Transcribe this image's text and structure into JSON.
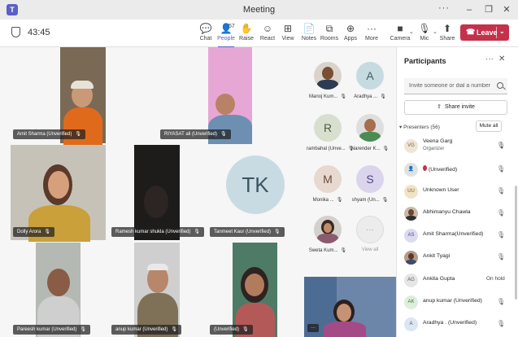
{
  "window": {
    "title": "Meeting",
    "app_icon": "teams-icon",
    "more": "···",
    "minimize": "–",
    "restore": "❐",
    "close": "✕"
  },
  "toolbar": {
    "timer": "43:45",
    "people_count": "57",
    "chat": "Chat",
    "people": "People",
    "raise": "Raise",
    "react": "React",
    "view": "View",
    "notes": "Notes",
    "rooms": "Rooms",
    "apps": "Apps",
    "more": "More",
    "camera": "Camera",
    "mic": "Mic",
    "share": "Share",
    "leave": "Leave",
    "leave_color": "#c4314b",
    "accent": "#5b5fc7"
  },
  "videos": [
    {
      "name": "Amit Sharma (Unverified)"
    },
    {
      "name": "RIYASAT ali (Unverified)"
    },
    {
      "name": "Dolly Arora"
    },
    {
      "name": "Ramesh kumar shukla (Unverified)"
    },
    {
      "name": "Tanmeet Kaur (Unverified)",
      "initials": "TK"
    },
    {
      "name": "Pareesh kumar (Unverified)"
    },
    {
      "name": "anup kumar (Unverified)"
    },
    {
      "name": "(Unverified)"
    }
  ],
  "gallery": [
    {
      "name": "Manoj Kum...",
      "initials": ""
    },
    {
      "name": "Aradhya ...",
      "initials": "A"
    },
    {
      "name": "rambahal (Unve...",
      "initials": "R"
    },
    {
      "name": "Narender K...",
      "initials": ""
    },
    {
      "name": "Monika ...",
      "initials": "M"
    },
    {
      "name": "shyam (Un...",
      "initials": "S"
    },
    {
      "name": "Sweta Kum...",
      "initials": ""
    },
    {
      "name": "View all",
      "initials": "···"
    }
  ],
  "participants_pane": {
    "title": "Participants",
    "more": "···",
    "close": "✕",
    "invite_placeholder": "Invite someone or dial a number",
    "share_invite": "Share invite",
    "presenters_label": "Presenters (56)",
    "mute_all": "Mute all",
    "people": [
      {
        "initials": "VG",
        "name": "Veena Garg",
        "sub": "Organizer",
        "status": "mic-on"
      },
      {
        "initials": "",
        "name": "(Unverified)",
        "sub": "",
        "status": "muted"
      },
      {
        "initials": "UU",
        "name": "Unknown User",
        "sub": "",
        "status": "muted"
      },
      {
        "initials": "",
        "name": "Abhimanyu Chawla",
        "sub": "",
        "status": "muted"
      },
      {
        "initials": "AS",
        "name": "Amit Sharma(Unverified)",
        "sub": "",
        "status": "muted"
      },
      {
        "initials": "",
        "name": "Ankit Tyagi",
        "sub": "",
        "status": "muted"
      },
      {
        "initials": "AG",
        "name": "Ankita Gupta",
        "sub": "",
        "status": "On hold"
      },
      {
        "initials": "AK",
        "name": "anup kumar (Unverified)",
        "sub": "",
        "status": "muted"
      },
      {
        "initials": "A",
        "name": "Aradhya . (Unverified)",
        "sub": "",
        "status": "muted"
      }
    ]
  }
}
